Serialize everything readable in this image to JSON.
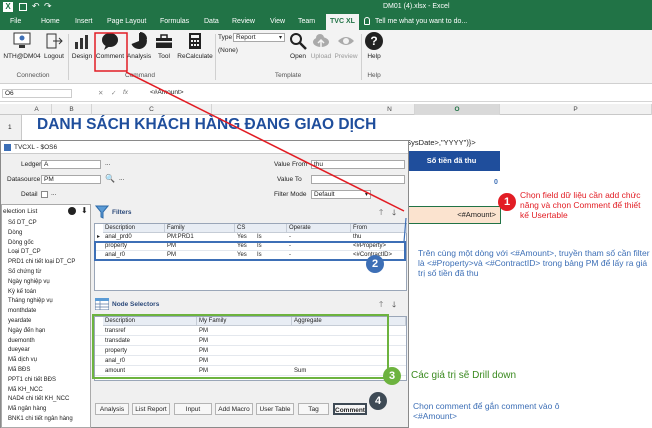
{
  "titlebar": {
    "file_title": "DM01 (4).xlsx - Excel"
  },
  "tabs": [
    {
      "label": "File"
    },
    {
      "label": "Home"
    },
    {
      "label": "Insert"
    },
    {
      "label": "Page Layout"
    },
    {
      "label": "Formulas"
    },
    {
      "label": "Data"
    },
    {
      "label": "Review"
    },
    {
      "label": "View"
    },
    {
      "label": "Team"
    },
    {
      "label": "TVC XL"
    }
  ],
  "tellme": "Tell me what you want to do...",
  "ribbon": {
    "connection_btn": "NTH@DM04",
    "logout_btn": "Logout",
    "design_btn": "Design",
    "comment_btn": "Comment",
    "analysis_btn": "Analysis",
    "tool_btn": "Tool",
    "recalc_btn": "ReCalculate",
    "type_label": "Type",
    "type_value": "Report",
    "type_none": "(None)",
    "open_btn": "Open",
    "upload_btn": "Upload",
    "preview_btn": "Preview",
    "help_btn": "Help",
    "group_connection": "Connection",
    "group_command": "Command",
    "group_template": "Template",
    "group_help": "Help"
  },
  "formula": {
    "name_box": "O6",
    "fx": "fx",
    "content": "<#Amount>"
  },
  "columns": [
    "A",
    "B",
    "C",
    "N",
    "O",
    "P"
  ],
  "sheet": {
    "row1_num": "1",
    "title": "DANH SÁCH KHÁCH HÀNG ĐANG GIAO DỊCH",
    "formula_frag": "#SysDate>,\"YYYY\")}>",
    "header_cell": "Số tiền đã thu",
    "zero1": "0",
    "zero2": "0",
    "zero3": "0",
    "amount_cell": "<#Amount>"
  },
  "dialog": {
    "title": "TVCXL - $OS6",
    "ledger_label": "Ledger",
    "ledger_value": "A",
    "datasource_label": "Datasource",
    "datasource_value": "PM",
    "detail_label": "Detail",
    "value_from_label": "Value From",
    "value_from": "thu",
    "value_to_label": "Value To",
    "filter_mode_label": "Filter Mode",
    "filter_mode": "Default",
    "selection_list_title": "election List",
    "selection_items": [
      "Số DT_CP",
      "Dòng",
      "Dòng gốc",
      "Loại DT_CP",
      "PRD1 chi tiết loại DT_CP",
      "Số chứng từ",
      "Ngày nghiệp vụ",
      "Kỳ kế toán",
      "Tháng nghiệp vụ",
      "monthdate",
      "yeardate",
      "Ngày đến hạn",
      "duemonth",
      "dueyear",
      "Mã dịch vụ",
      "Mã BĐS",
      "PPT1 chi tiết BĐS",
      "Mã KH_NCC",
      "NAD4 chi tiết KH_NCC",
      "Mã ngân hàng",
      "BNK1 chi tiết ngân hàng"
    ],
    "filters": {
      "title": "Filters",
      "headers": [
        "Description",
        "Family",
        "CS",
        "Operate",
        "From"
      ],
      "rows": [
        [
          "anal_prd0",
          "PM:PRD1",
          "Yes",
          "Is",
          "-",
          "thu"
        ],
        [
          "property",
          "PM",
          "Yes",
          "Is",
          "-",
          "<#Property>"
        ],
        [
          "anal_r0",
          "PM",
          "Yes",
          "Is",
          "-",
          "<#ContractID>"
        ]
      ]
    },
    "node_selectors": {
      "title": "Node Selectors",
      "headers": [
        "Description",
        "My Family",
        "Aggregate"
      ],
      "rows": [
        [
          "transref",
          "PM",
          ""
        ],
        [
          "transdate",
          "PM",
          ""
        ],
        [
          "property",
          "PM",
          ""
        ],
        [
          "anal_r0",
          "PM",
          ""
        ],
        [
          "amount",
          "PM",
          "Sum"
        ]
      ]
    },
    "bottom_tabs": [
      "Analysis",
      "List Report",
      "Input",
      "Add Macro",
      "User Table",
      "Tag",
      "Comment"
    ]
  },
  "annotations": {
    "n1": "1",
    "n2": "2",
    "n3": "3",
    "n4": "4",
    "note1": "Chọn field dữ liệu cần add chức năng và chọn Comment để thiết kế Usertable",
    "note2": "Trên cùng một dòng với <#Amount>, truyền tham số cần filter là <#Property>và <#ContractID> trong bảng PM để lấy ra giá trị số tiền đã thu",
    "note3": "Các giá trị sẽ Drill down",
    "note4": "Chọn comment để gắn comment vào ô <#Amount>",
    "colors": {
      "excel_green": "#217346",
      "badge_red": "#e21d24",
      "badge_blue": "#3d6fb6",
      "badge_green": "#6db33f",
      "badge_dark": "#3e4a55"
    }
  }
}
